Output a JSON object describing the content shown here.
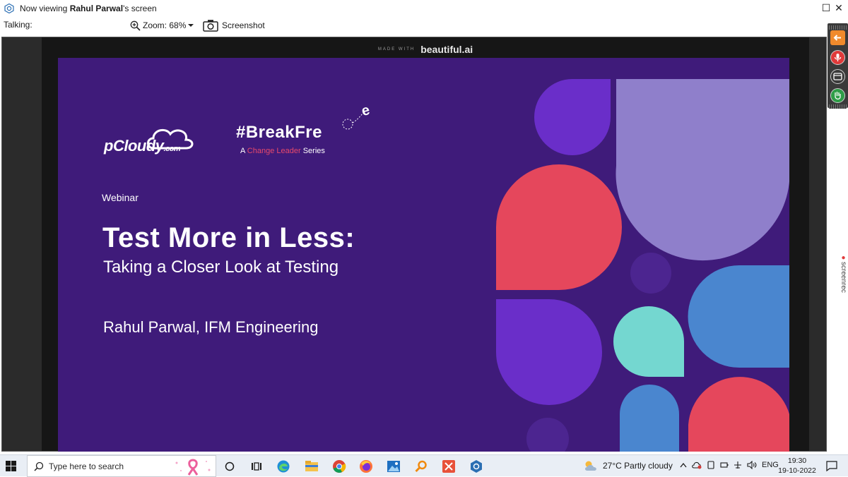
{
  "window": {
    "title_prefix": "Now viewing ",
    "title_name": "Rahul Parwal",
    "title_suffix": "'s screen",
    "controls": {
      "restore": "☐",
      "close": "✕"
    }
  },
  "toolbar": {
    "talking_label": "Talking:",
    "zoom_label": "Zoom: 68%",
    "screenshot_label": "Screenshot"
  },
  "viewer": {
    "made_with_small": "MADE WITH",
    "made_with_brand": "beautiful.ai"
  },
  "slide": {
    "background_color": "#3f1b7a",
    "logo_wordmark": "pCloudy",
    "logo_suffix": ".com",
    "series_tag": "#BreakFre",
    "series_tag_tail": "e",
    "series_line_prefix": "A ",
    "series_line_accent": "Change Leader",
    "series_line_suffix": " Series",
    "label": "Webinar",
    "title": "Test More in Less:",
    "subtitle": "Taking a Closer Look at Testing",
    "presenter": "Rahul Parwal, IFM Engineering",
    "palette": {
      "purple": "#6a2ec9",
      "lavender": "#8f7fcb",
      "coral": "#e5475c",
      "blue": "#4a86cf",
      "teal": "#74d7d0",
      "deep": "#4c2590"
    }
  },
  "side_panel": {
    "watermark_brand": "screenrec",
    "buttons": [
      "exit-arrow-icon",
      "microphone-icon",
      "window-icon",
      "hand-icon"
    ]
  },
  "taskbar": {
    "search_placeholder": "Type here to search",
    "apps": [
      "task-view-icon",
      "multitasking-icon",
      "edge-icon",
      "file-explorer-icon",
      "chrome-icon",
      "firefox-icon",
      "photos-icon",
      "search-tool-icon",
      "snip-icon",
      "viewer-app-icon"
    ],
    "weather": "27°C  Partly cloudy",
    "language": "ENG",
    "time": "19:30",
    "date": "19-10-2022"
  }
}
